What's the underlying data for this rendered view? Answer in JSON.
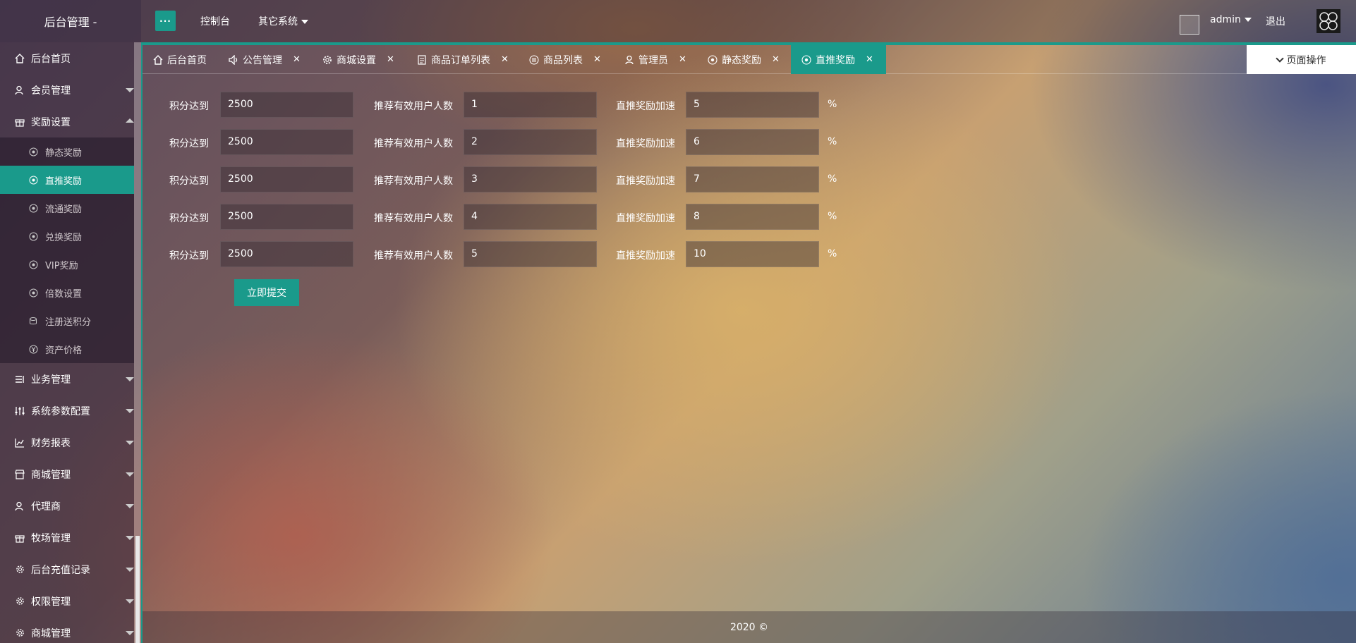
{
  "header": {
    "app_title": "后台管理 -",
    "menu_toggle_label": "···",
    "nav": {
      "dashboard": "控制台",
      "other_systems": "其它系统"
    },
    "user": {
      "name": "admin",
      "logout": "退出"
    }
  },
  "sidebar": {
    "home": "后台首页",
    "member": "会员管理",
    "rewards": {
      "label": "奖励设置",
      "children": [
        "静态奖励",
        "直推奖励",
        "流通奖励",
        "兑换奖励",
        "VIP奖励",
        "倍数设置",
        "注册送积分",
        "资产价格"
      ]
    },
    "business": "业务管理",
    "sys_params": "系统参数配置",
    "finance": "财务报表",
    "mall": "商城管理",
    "agent": "代理商",
    "ranch": "牧场管理",
    "recharge": "后台充值记录",
    "permission": "权限管理",
    "mall2": "商城管理"
  },
  "tabs": [
    "后台首页",
    "公告管理",
    "商城设置",
    "商品订单列表",
    "商品列表",
    "管理员",
    "静态奖励",
    "直推奖励"
  ],
  "page_ops": "页面操作",
  "form": {
    "labels": {
      "points": "积分达到",
      "referrals": "推荐有效用户人数",
      "speedup": "直推奖励加速",
      "percent": "%"
    },
    "rows": [
      {
        "points": "2500",
        "referrals": "1",
        "speedup": "5"
      },
      {
        "points": "2500",
        "referrals": "2",
        "speedup": "6"
      },
      {
        "points": "2500",
        "referrals": "3",
        "speedup": "7"
      },
      {
        "points": "2500",
        "referrals": "4",
        "speedup": "8"
      },
      {
        "points": "2500",
        "referrals": "5",
        "speedup": "10"
      }
    ],
    "submit": "立即提交"
  },
  "footer": "2020 ©",
  "colors": {
    "accent": "#1a9a8b"
  }
}
